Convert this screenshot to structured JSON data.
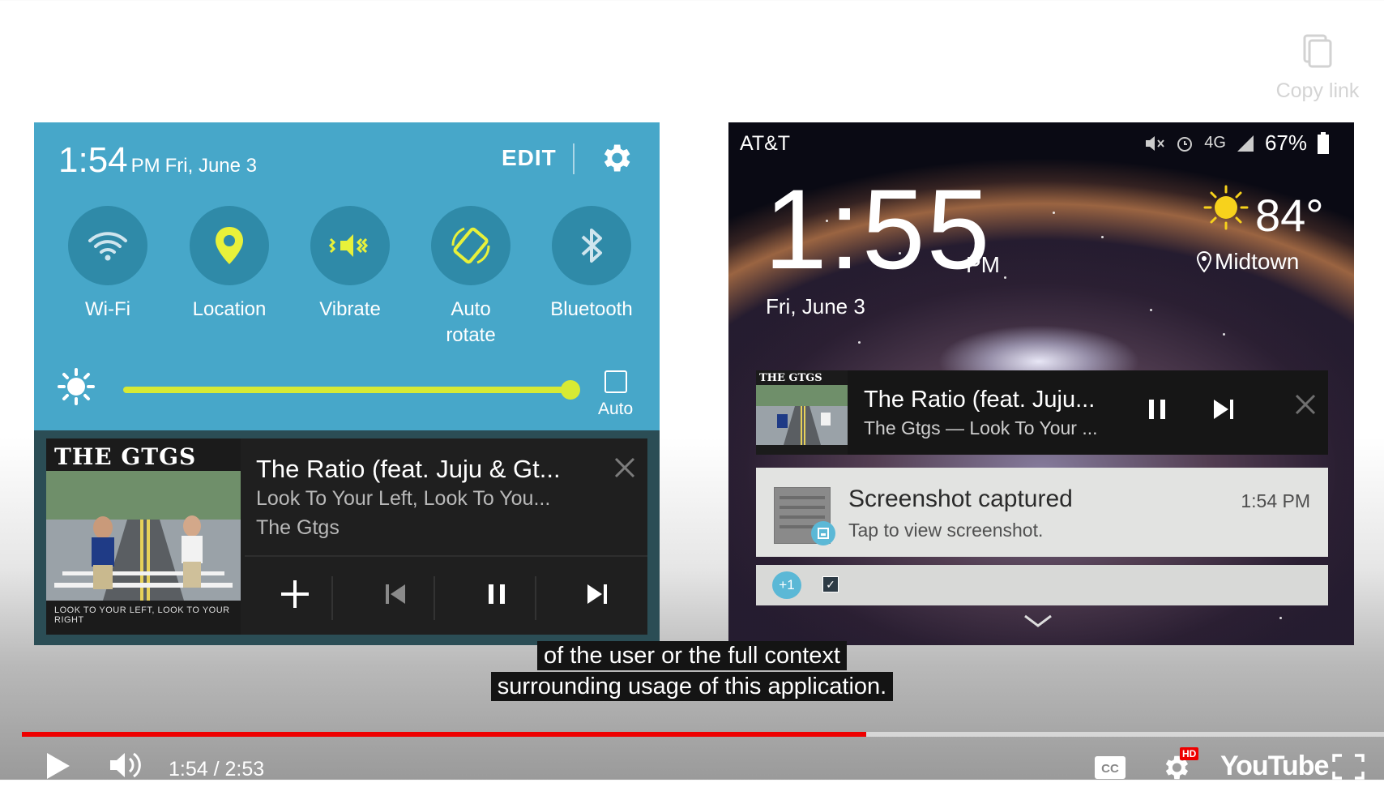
{
  "copy_link": {
    "label": "Copy link",
    "icon": "copy-icon"
  },
  "left_panel": {
    "time": "1:54",
    "ampm": "PM",
    "date": "Fri, June 3",
    "edit_label": "EDIT",
    "settings_icon": "gear-icon",
    "quick_settings": [
      {
        "label": "Wi-Fi",
        "icon": "wifi-icon"
      },
      {
        "label": "Location",
        "icon": "location-pin-icon"
      },
      {
        "label": "Vibrate",
        "icon": "vibrate-icon"
      },
      {
        "label": "Auto\nrotate",
        "icon": "auto-rotate-icon"
      },
      {
        "label": "Bluetooth",
        "icon": "bluetooth-icon"
      }
    ],
    "brightness": {
      "level": 0.93,
      "auto_label": "Auto",
      "auto_checked": false
    },
    "music": {
      "album_band": "THE GTGS",
      "album_caption": "LOOK TO YOUR LEFT, LOOK TO YOUR RIGHT",
      "title": "The Ratio (feat. Juju & Gt...",
      "album": "Look To Your Left, Look To You...",
      "artist": "The Gtgs"
    }
  },
  "right_panel": {
    "carrier": "AT&T",
    "battery": "67%",
    "time": "1:55",
    "ampm": "PM",
    "date": "Fri, June 3",
    "temperature": "84°",
    "location": "Midtown",
    "music": {
      "album_band": "THE GTGS",
      "title": "The Ratio (feat. Juju...",
      "subtitle": "The Gtgs — Look To Your ..."
    },
    "screenshot_notification": {
      "title": "Screenshot captured",
      "subtitle": "Tap to view screenshot.",
      "time": "1:54 PM"
    },
    "more_badge": "+1"
  },
  "captions": {
    "line1": "of the user or the full context",
    "line2": "surrounding usage of this application."
  },
  "player": {
    "time_display": "1:54 / 2:53",
    "progress": 0.62,
    "hd_badge": "HD",
    "cc_label": "CC",
    "brand": "YouTube",
    "accent_color": "#ee0000"
  }
}
